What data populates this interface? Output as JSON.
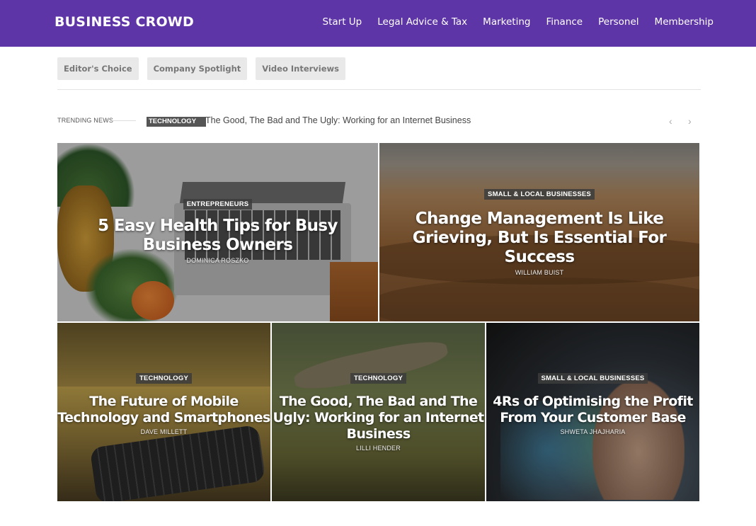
{
  "header": {
    "logo": "BUSINESS CROWD",
    "nav": [
      "Start Up",
      "Legal Advice & Tax",
      "Marketing",
      "Finance",
      "Personel",
      "Membership"
    ]
  },
  "tabs": [
    "Editor's Choice",
    "Company Spotlight",
    "Video Interviews"
  ],
  "trending": {
    "label": "TRENDING NEWS",
    "category": "TECHNOLOGY",
    "title": "The Good, The Bad and The Ugly: Working for an Internet Business",
    "prev_icon": "chevron-left-icon",
    "next_icon": "chevron-right-icon"
  },
  "cards": [
    {
      "category": "ENTREPRENEURS",
      "title": "5 Easy Health Tips for Busy Business Owners",
      "author": "DOMINICA ROSZKO"
    },
    {
      "category": "SMALL & LOCAL BUSINESSES",
      "title": "Change Management Is Like Grieving, But Is Essential For Success",
      "author": "WILLIAM BUIST"
    },
    {
      "category": "TECHNOLOGY",
      "title": "The Future of Mobile Technology and Smartphones",
      "author": "DAVE MILLETT"
    },
    {
      "category": "TECHNOLOGY",
      "title": "The Good, The Bad and The Ugly: Working for an Internet Business",
      "author": "LILLI HENDER"
    },
    {
      "category": "SMALL & LOCAL BUSINESSES",
      "title": "4Rs of Optimising the Profit From Your Customer Base",
      "author": "SHWETA JHAJHARIA"
    }
  ],
  "colors": {
    "header_bg": "#5e35a6",
    "tab_bg": "#e9e9e9",
    "badge_bg": "#3c3c3c"
  }
}
